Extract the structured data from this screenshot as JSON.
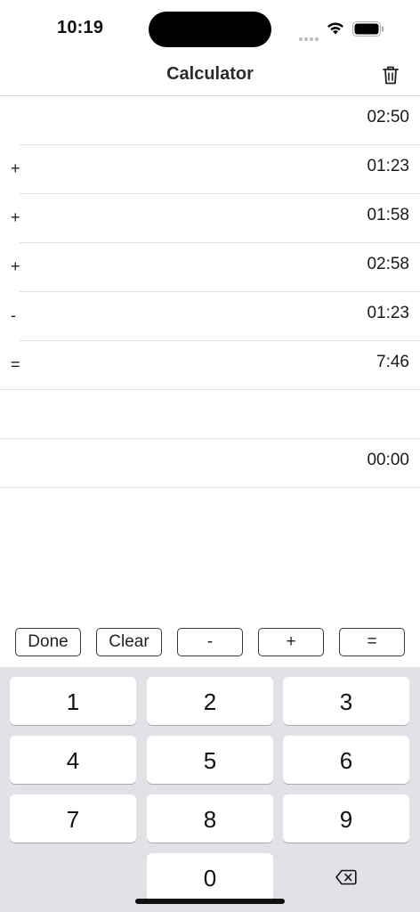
{
  "status_bar": {
    "time": "10:19"
  },
  "nav": {
    "title": "Calculator",
    "trash_icon": "trash-icon"
  },
  "rows": [
    {
      "op": "",
      "value": "02:50"
    },
    {
      "op": "+",
      "value": "01:23"
    },
    {
      "op": "+",
      "value": "01:58"
    },
    {
      "op": "+",
      "value": "02:58"
    },
    {
      "op": "-",
      "value": "01:23"
    },
    {
      "op": "=",
      "value": "7:46"
    },
    {
      "op": "",
      "value": ""
    },
    {
      "op": "",
      "value": "00:00"
    }
  ],
  "toolbar": {
    "done_label": "Done",
    "clear_label": "Clear",
    "minus_label": "-",
    "plus_label": "+",
    "equals_label": "="
  },
  "keypad": {
    "keys": [
      "1",
      "2",
      "3",
      "4",
      "5",
      "6",
      "7",
      "8",
      "9",
      "0"
    ],
    "delete_icon": "backspace-icon"
  },
  "colors": {
    "keypad_background": "#e1e2e7",
    "separator": "#e2e2e2"
  }
}
